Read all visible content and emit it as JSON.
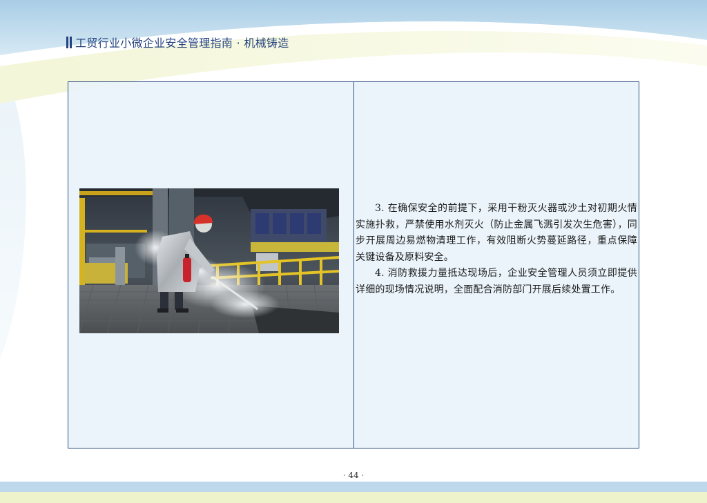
{
  "header": {
    "title": "工贸行业小微企业安全管理指南 · 机械铸造"
  },
  "content": {
    "image_description_icon": "fire-extinguisher-photo",
    "paragraphs": [
      "3. 在确保安全的前提下，采用干粉灭火器或沙土对初期火情实施扑救，严禁使用水剂灭火（防止金属飞溅引发次生危害），同步开展周边易燃物清理工作，有效阻断火势蔓延路径，重点保障关键设备及原料安全。",
      "4. 消防救援力量抵达现场后，企业安全管理人员须立即提供详细的现场情况说明，全面配合消防部门开展后续处置工作。"
    ]
  },
  "footer": {
    "page_number": "· 44 ·"
  },
  "colors": {
    "header_text": "#24427e",
    "table_border": "#2d4d80",
    "table_fill": "#e8f3fa",
    "band_blue": "#bcd8ea",
    "band_yellow": "#eef3cc"
  }
}
